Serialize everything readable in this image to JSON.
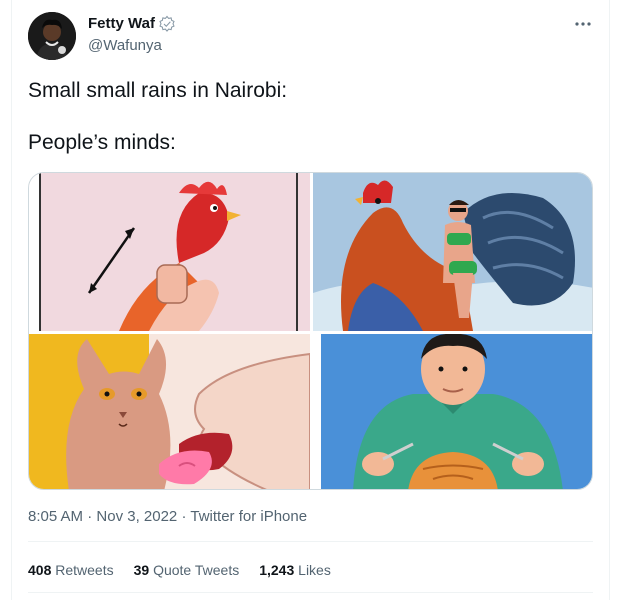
{
  "tweet": {
    "author": {
      "display_name": "Fetty Waf",
      "handle": "@Wafunya",
      "verified_icon": "verified-badge-icon"
    },
    "text_line1": "Small small rains in Nairobi:",
    "text_line2": "People’s minds:",
    "media": [
      {
        "alt": "hand holding rooster"
      },
      {
        "alt": "woman riding giant rooster"
      },
      {
        "alt": "sphynx cat and licking tongue"
      },
      {
        "alt": "man eating cat with fork and knife"
      }
    ],
    "meta": {
      "time": "8:05 AM",
      "date": "Nov 3, 2022",
      "source": "Twitter for iPhone",
      "separator": "·"
    },
    "stats": {
      "retweets_count": "408",
      "retweets_label": "Retweets",
      "quotes_count": "39",
      "quotes_label": "Quote Tweets",
      "likes_count": "1,243",
      "likes_label": "Likes"
    }
  },
  "colors": {
    "text_primary": "#0f1419",
    "text_secondary": "#536471",
    "border": "#eff3f4"
  }
}
